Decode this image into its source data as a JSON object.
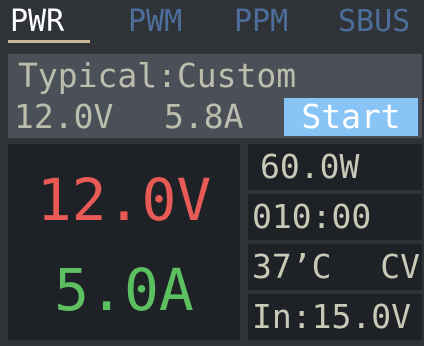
{
  "tabs": [
    {
      "label": "PWR",
      "active": true
    },
    {
      "label": "PWM",
      "active": false
    },
    {
      "label": "PPM",
      "active": false
    },
    {
      "label": "SBUS",
      "active": false
    }
  ],
  "settings": {
    "preset": "Typical:Custom",
    "set_voltage": "12.0V",
    "set_current": "5.8A",
    "start_label": "Start"
  },
  "output": {
    "voltage": "12.0V",
    "current": "5.0A"
  },
  "info": {
    "power": "60.0W",
    "time": "010:00",
    "temperature": "37’C",
    "mode": "CV",
    "input": "In:15.0V"
  },
  "colors": {
    "background": "#2f3338",
    "panel": "#4b5058",
    "display": "#1e2226",
    "voltage": "#e85a55",
    "current": "#5cc061",
    "button": "#89c4f6",
    "tab_inactive": "#4d6e9a"
  }
}
